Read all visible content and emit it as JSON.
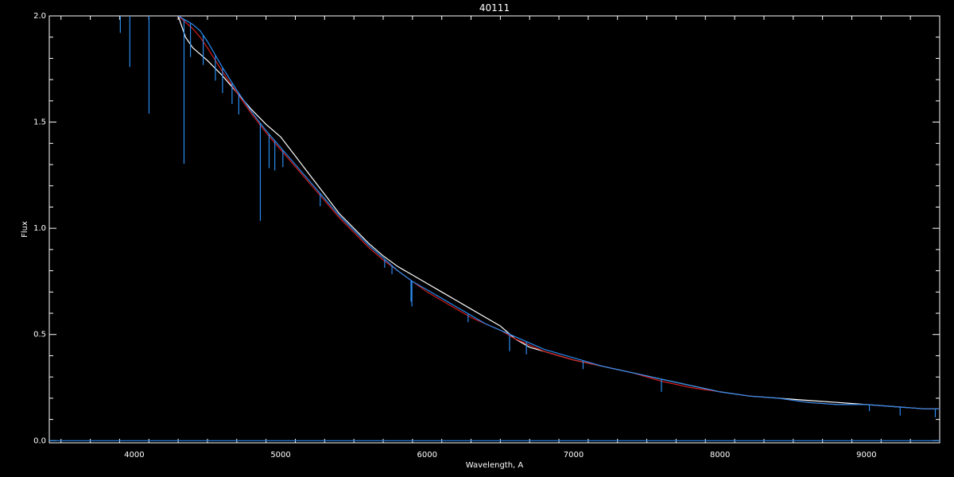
{
  "chart_data": {
    "type": "line",
    "title": "40111",
    "xlabel": "Wavelength, A",
    "ylabel": "Flux",
    "xlim": [
      3420,
      9500
    ],
    "ylim": [
      -0.01,
      2.0
    ],
    "xticks": [
      4000,
      5000,
      6000,
      7000,
      8000,
      9000
    ],
    "xtick_labels": [
      "4000",
      "5000",
      "6000",
      "7000",
      "8000",
      "9000"
    ],
    "yticks": [
      0.0,
      0.5,
      1.0,
      1.5,
      2.0
    ],
    "ytick_labels": [
      "0.0",
      "0.5",
      "1.0",
      "1.5",
      "2.0"
    ],
    "grid": false,
    "series": [
      {
        "color": "#ffffff",
        "x": [
          4300,
          4350,
          4400,
          4450,
          4500,
          4600,
          4700,
          4800,
          4900,
          5000,
          5100,
          5200,
          5300,
          5400,
          5500,
          5600,
          5700,
          5800,
          5900,
          6000,
          6100,
          6200,
          6300,
          6400,
          6500,
          6600,
          6700,
          6800,
          6900,
          7000,
          7200,
          7400,
          7600,
          7800,
          8000,
          8200,
          8400,
          8600,
          8800,
          9000,
          9200,
          9400,
          9500
        ],
        "y": [
          2.0,
          1.9,
          1.85,
          1.82,
          1.79,
          1.72,
          1.64,
          1.56,
          1.49,
          1.43,
          1.34,
          1.25,
          1.16,
          1.07,
          1.0,
          0.93,
          0.87,
          0.82,
          0.78,
          0.74,
          0.7,
          0.66,
          0.62,
          0.58,
          0.54,
          0.48,
          0.44,
          0.42,
          0.4,
          0.38,
          0.35,
          0.32,
          0.29,
          0.26,
          0.23,
          0.21,
          0.2,
          0.19,
          0.18,
          0.17,
          0.16,
          0.15,
          0.15
        ]
      },
      {
        "color": "#d21e1e",
        "x": [
          4300,
          4350,
          4400,
          4450,
          4500,
          4600,
          4700,
          4800,
          4900,
          5000,
          5100,
          5200,
          5300,
          5400,
          5500,
          5600,
          5700,
          5800,
          5900,
          6000,
          6100,
          6200,
          6300,
          6400,
          6500,
          6600,
          6700,
          6800,
          6900,
          7000,
          7200,
          7400,
          7600,
          7800,
          8000,
          8200,
          8400,
          8600,
          8800,
          9000,
          9200,
          9400,
          9500
        ],
        "y": [
          2.0,
          1.97,
          1.94,
          1.9,
          1.85,
          1.74,
          1.64,
          1.54,
          1.45,
          1.37,
          1.29,
          1.21,
          1.13,
          1.05,
          0.98,
          0.91,
          0.85,
          0.8,
          0.75,
          0.7,
          0.66,
          0.62,
          0.58,
          0.55,
          0.52,
          0.48,
          0.45,
          0.42,
          0.4,
          0.38,
          0.35,
          0.32,
          0.28,
          0.25,
          0.23,
          0.21,
          0.2,
          0.18,
          0.17,
          0.17,
          0.16,
          0.15,
          0.15
        ]
      },
      {
        "color": "#2a8cf0",
        "x": [
          4300,
          4350,
          4400,
          4450,
          4500,
          4600,
          4700,
          4800,
          4900,
          5000,
          5100,
          5200,
          5300,
          5400,
          5500,
          5600,
          5700,
          5800,
          5900,
          6000,
          6100,
          6200,
          6300,
          6400,
          6500,
          6600,
          6700,
          6800,
          6900,
          7000,
          7200,
          7400,
          7600,
          7800,
          8000,
          8200,
          8400,
          8600,
          8800,
          9000,
          9200,
          9400,
          9500
        ],
        "y": [
          2.0,
          1.98,
          1.96,
          1.93,
          1.88,
          1.76,
          1.65,
          1.55,
          1.46,
          1.38,
          1.3,
          1.22,
          1.14,
          1.06,
          0.99,
          0.92,
          0.86,
          0.8,
          0.75,
          0.71,
          0.67,
          0.63,
          0.59,
          0.55,
          0.52,
          0.49,
          0.46,
          0.43,
          0.41,
          0.39,
          0.35,
          0.32,
          0.29,
          0.26,
          0.23,
          0.21,
          0.2,
          0.18,
          0.17,
          0.17,
          0.16,
          0.15,
          0.15
        ]
      },
      {
        "color": "#2a8cf0",
        "x": [
          3420,
          4000,
          5000,
          6000,
          7000,
          8000,
          9000,
          9500
        ],
        "y": [
          0.0,
          0.0,
          0.0,
          0.0,
          0.0,
          0.0,
          0.0,
          0.0
        ]
      }
    ],
    "absorption_lines": [
      {
        "x": 3905,
        "depth": 0.08
      },
      {
        "x": 3970,
        "depth": 0.24
      },
      {
        "x": 4101,
        "depth": 0.46
      },
      {
        "x": 4340,
        "depth": 0.68
      },
      {
        "x": 4384,
        "depth": 0.16
      },
      {
        "x": 4471,
        "depth": 0.14
      },
      {
        "x": 4554,
        "depth": 0.12
      },
      {
        "x": 4603,
        "depth": 0.12
      },
      {
        "x": 4668,
        "depth": 0.1
      },
      {
        "x": 4714,
        "depth": 0.1
      },
      {
        "x": 4861,
        "depth": 0.46
      },
      {
        "x": 4921,
        "depth": 0.16
      },
      {
        "x": 4960,
        "depth": 0.14
      },
      {
        "x": 5015,
        "depth": 0.08
      },
      {
        "x": 5270,
        "depth": 0.06
      },
      {
        "x": 5710,
        "depth": 0.04
      },
      {
        "x": 5760,
        "depth": 0.04
      },
      {
        "x": 5890,
        "depth": 0.1
      },
      {
        "x": 5896,
        "depth": 0.12
      },
      {
        "x": 6280,
        "depth": 0.04
      },
      {
        "x": 6563,
        "depth": 0.08
      },
      {
        "x": 6678,
        "depth": 0.06
      },
      {
        "x": 7065,
        "depth": 0.04
      },
      {
        "x": 7600,
        "depth": 0.06
      },
      {
        "x": 9020,
        "depth": 0.03
      },
      {
        "x": 9230,
        "depth": 0.04
      },
      {
        "x": 9470,
        "depth": 0.04
      }
    ]
  }
}
